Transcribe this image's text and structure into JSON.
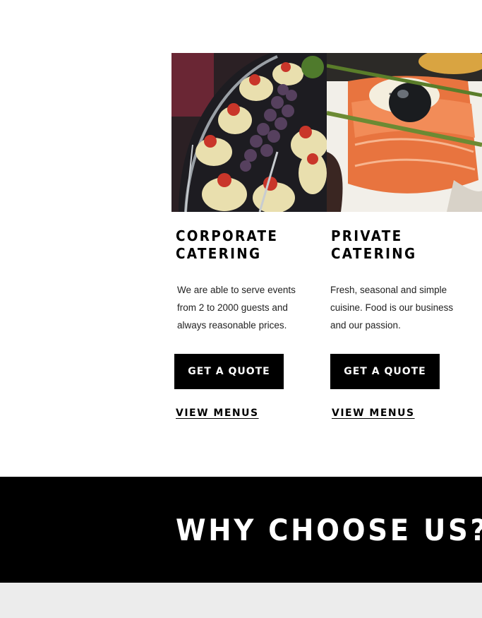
{
  "services": [
    {
      "title_line1": "CORPORATE",
      "title_line2": "CATERING",
      "description": "We are able to serve events from 2 to 2000 guests and always reasonable prices.",
      "quote_label": "GET A QUOTE",
      "menus_label": "VIEW MENUS"
    },
    {
      "title_line1": "PRIVATE",
      "title_line2": "CATERING",
      "description": "Fresh, seasonal and simple cuisine. Food is our business and our passion.",
      "quote_label": "GET A QUOTE",
      "menus_label": "VIEW MENUS"
    }
  ],
  "why": {
    "heading": "WHY CHOOSE US?"
  },
  "colors": {
    "band": "#000000",
    "button": "#000000",
    "strip": "#ececec"
  }
}
